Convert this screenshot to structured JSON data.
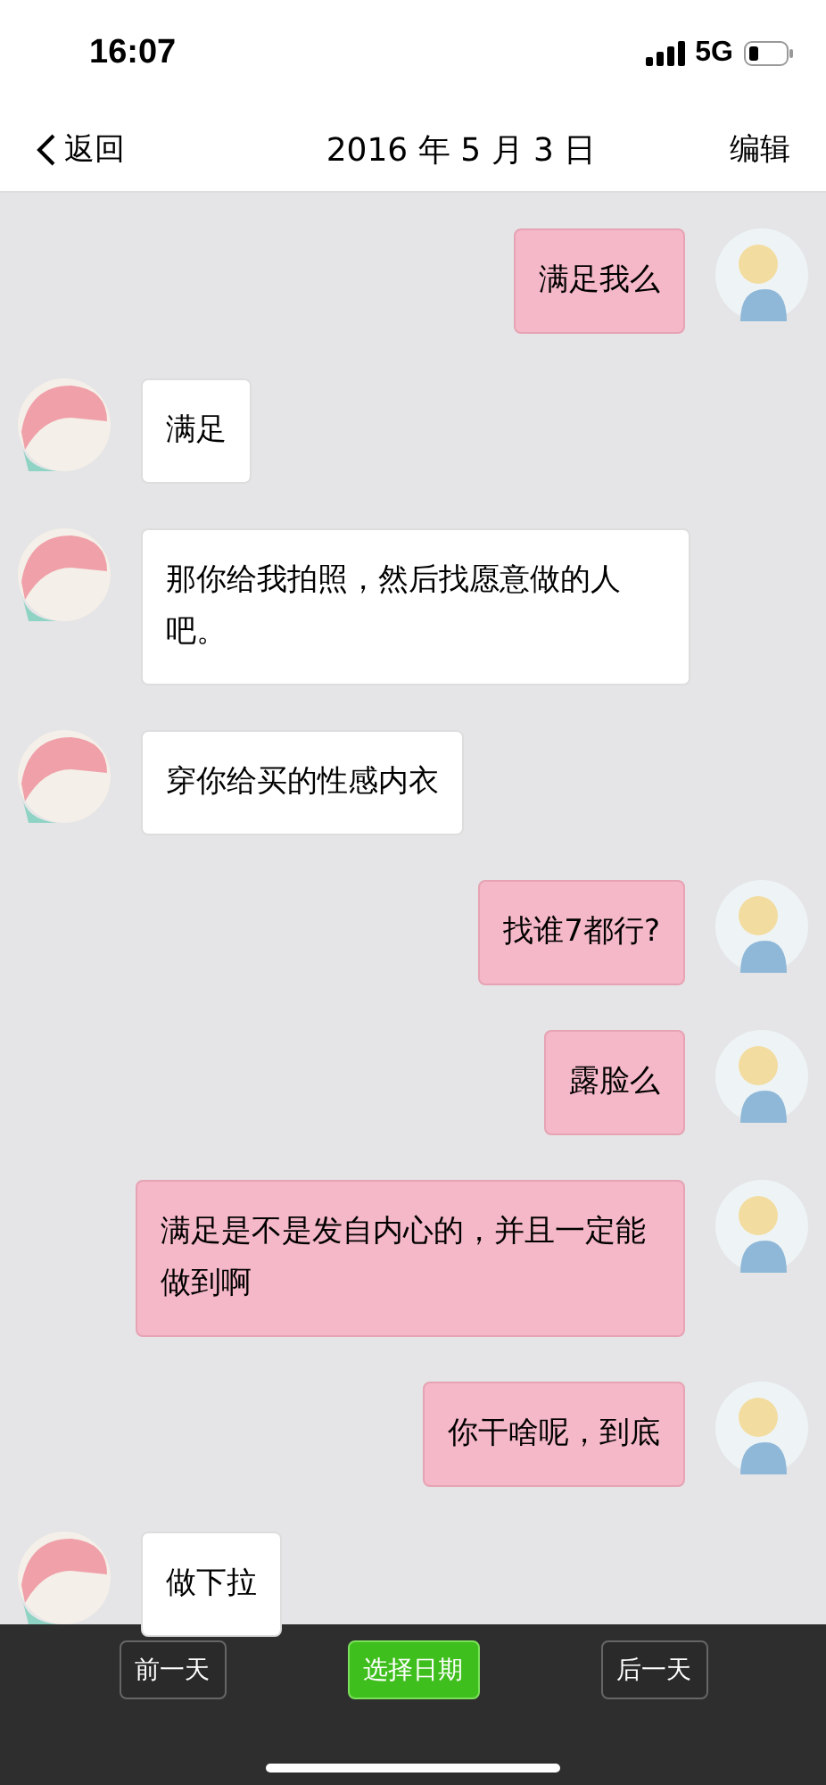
{
  "status_bar": {
    "time": "16:07",
    "network": "5G"
  },
  "nav_bar": {
    "back": "返回",
    "title": "2016 年 5 月 3 日",
    "action": "编辑"
  },
  "messages": [
    {
      "kind": "sent",
      "text": "满足我么"
    },
    {
      "kind": "received",
      "text": "满足"
    },
    {
      "kind": "received",
      "text": "那你给我拍照，然后找愿意做的人吧。"
    },
    {
      "kind": "received",
      "text": "穿你给买的性感内衣"
    },
    {
      "kind": "sent",
      "text": "找谁7都行?"
    },
    {
      "kind": "sent",
      "text": "露脸么"
    },
    {
      "kind": "sent",
      "text": "满足是不是发自内心的，并且一定能做到啊"
    },
    {
      "kind": "sent",
      "text": "你干啥呢，到底"
    },
    {
      "kind": "received",
      "text": "做下拉"
    }
  ],
  "toolbar": [
    {
      "label": "前一天",
      "selected": false
    },
    {
      "label": "选择日期",
      "selected": true
    },
    {
      "label": "后一天",
      "selected": false
    }
  ]
}
